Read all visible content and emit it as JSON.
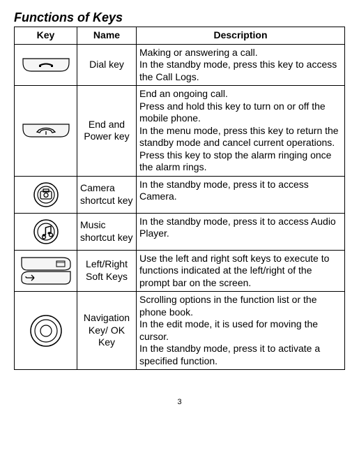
{
  "heading": "Functions of Keys",
  "headers": {
    "key": "Key",
    "name": "Name",
    "desc": "Description"
  },
  "rows": [
    {
      "name": "Dial key",
      "name_align": "center",
      "desc": "Making or answering a call.\nIn the standby mode, press this key to access the Call Logs."
    },
    {
      "name": "End and Power key",
      "name_align": "center",
      "desc": "End an ongoing call.\nPress and hold this key to turn on or off the mobile phone.\nIn the menu mode, press this key to return the standby mode and cancel current operations.\nPress this key to stop the alarm ringing once the alarm rings."
    },
    {
      "name": "Camera shortcut key",
      "name_align": "left",
      "desc": "In the standby mode, press it to access Camera."
    },
    {
      "name": "Music shortcut key",
      "name_align": "left",
      "desc": "In the standby mode, press it to access Audio Player."
    },
    {
      "name": "Left/Right Soft Keys",
      "name_align": "center",
      "desc": "Use the left and right soft keys to execute to functions indicated at the left/right of the prompt bar on the screen."
    },
    {
      "name": "Navigation Key/ OK Key",
      "name_align": "center",
      "desc": "Scrolling options in the function list or the phone book.\nIn the edit mode, it is used for moving the cursor.\nIn the standby mode, press it to activate a specified function."
    }
  ],
  "page_number": "3"
}
